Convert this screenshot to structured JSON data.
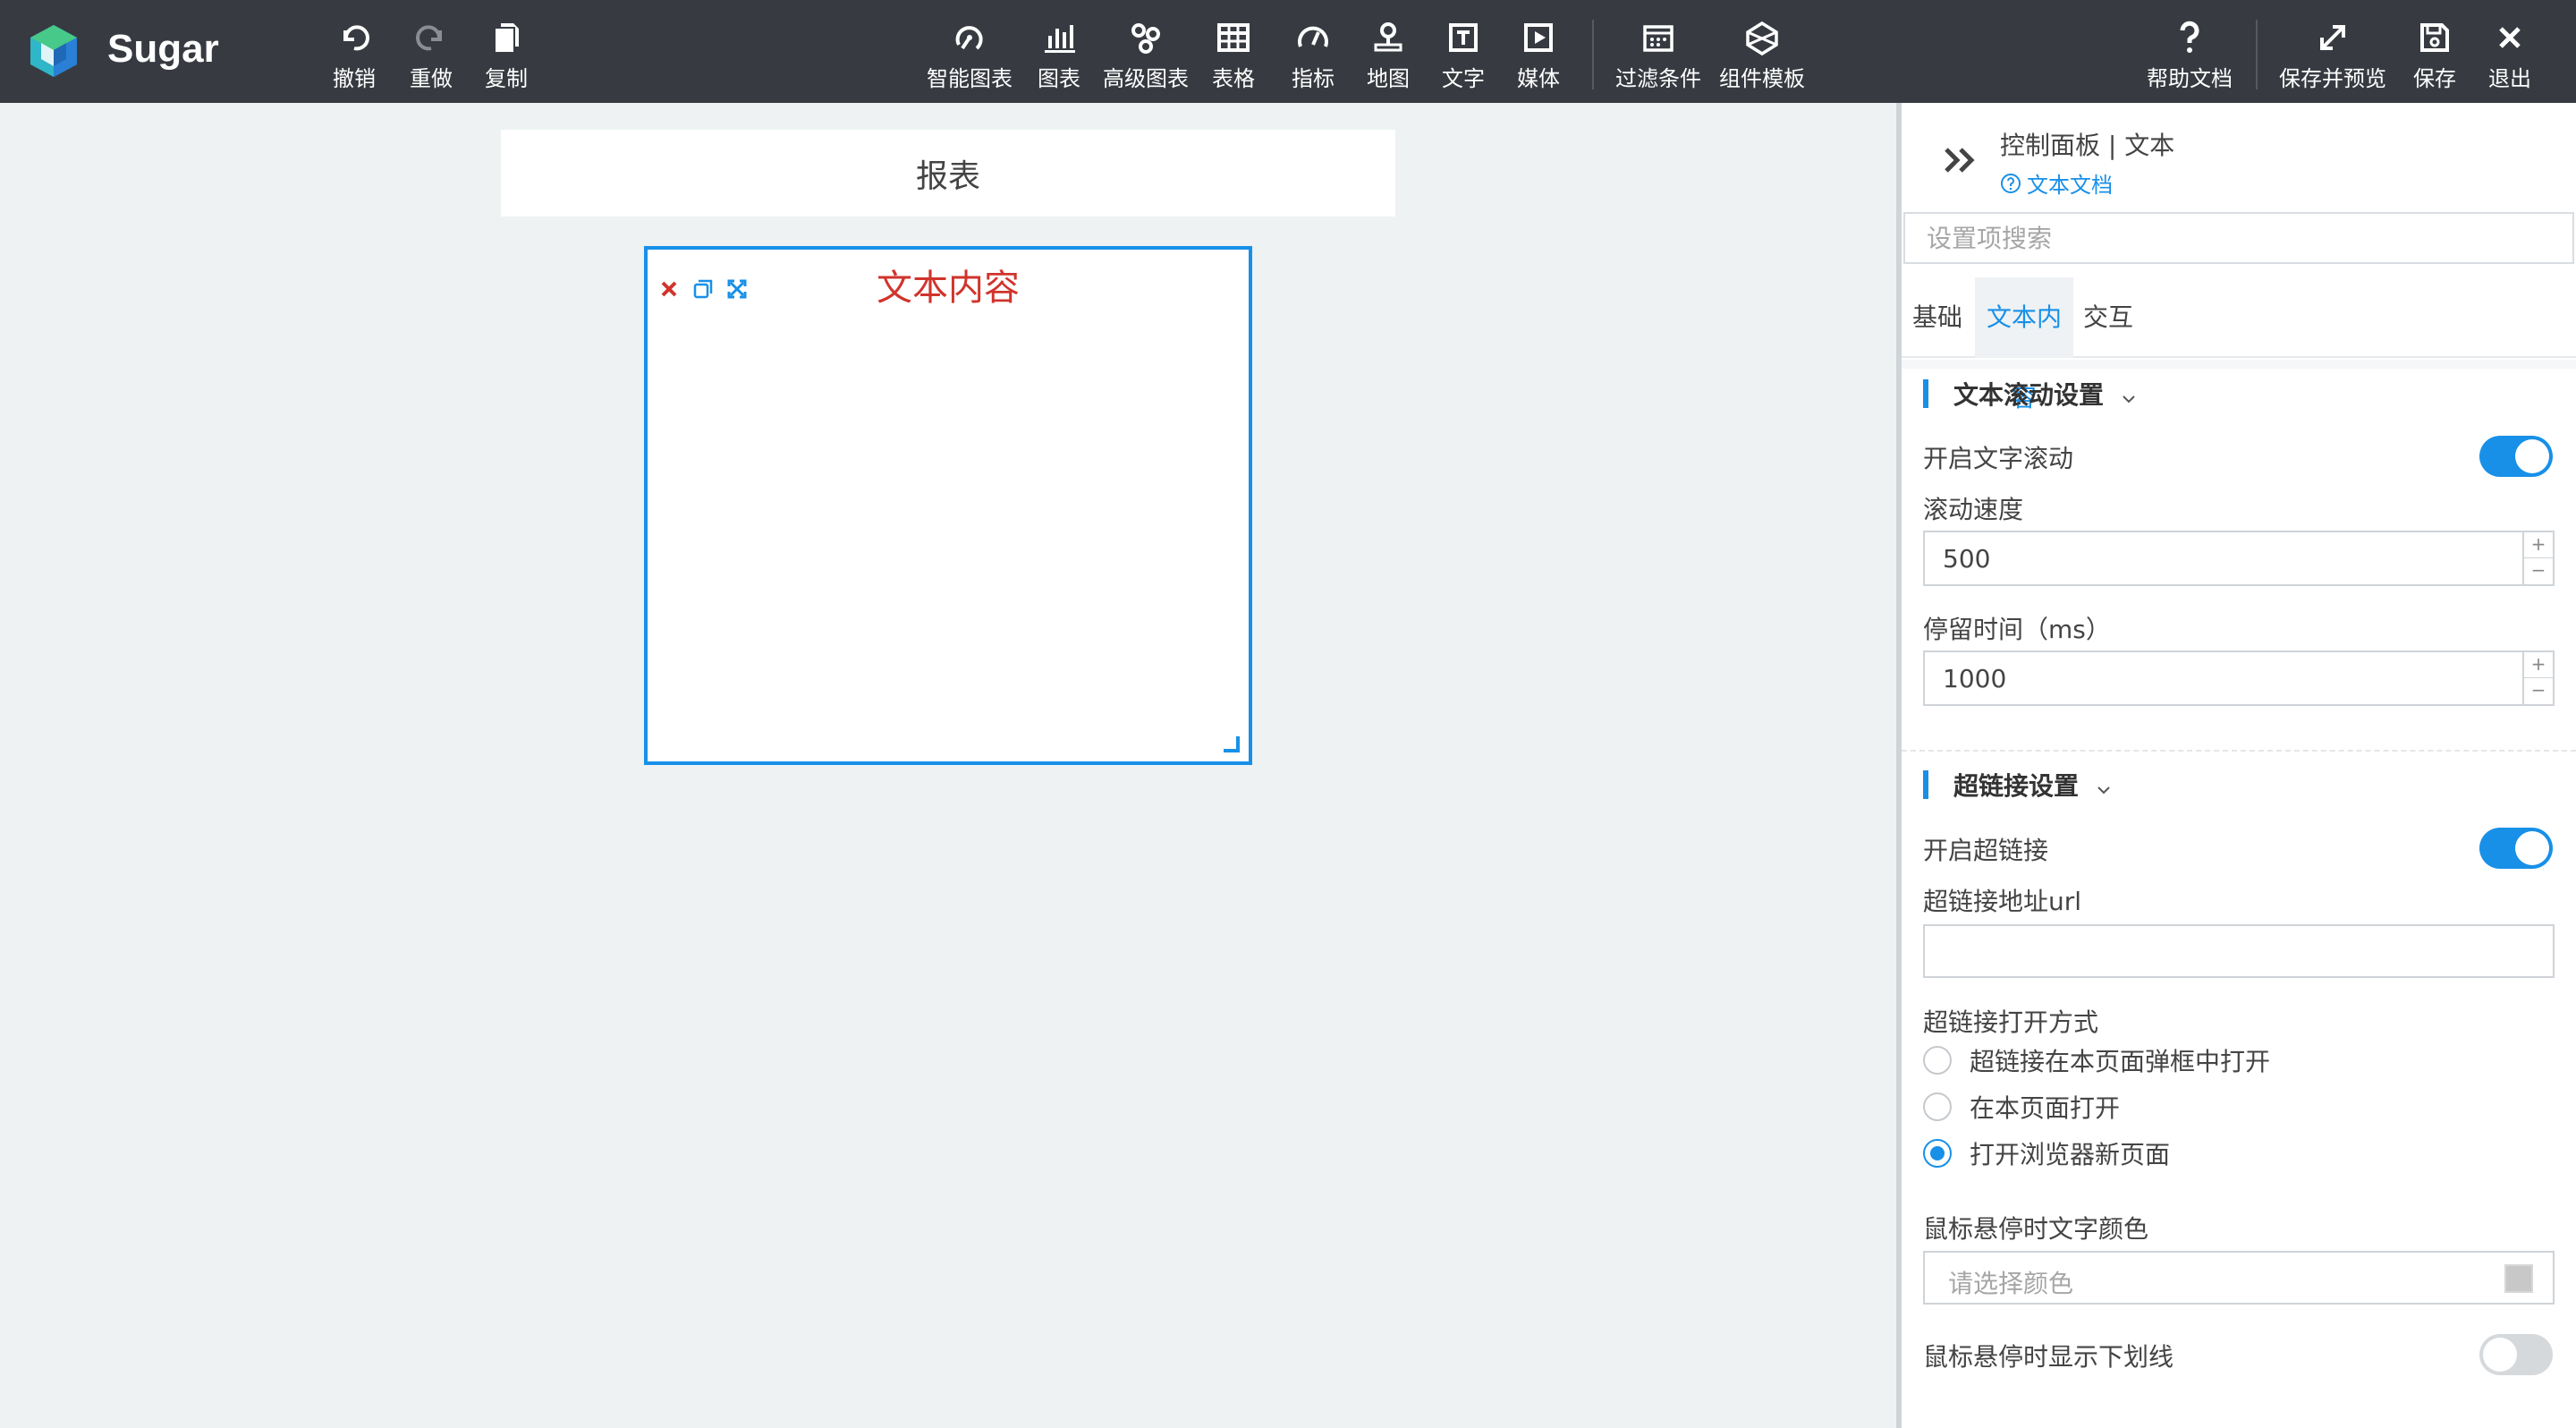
{
  "app": {
    "name": "Sugar",
    "accent_color": "#1890e8",
    "topbar_color": "#373b41",
    "canvas_color": "#eef2f3"
  },
  "toolbar": {
    "edit": [
      {
        "label": "撤销",
        "icon": "undo-icon"
      },
      {
        "label": "重做",
        "icon": "redo-icon"
      },
      {
        "label": "复制",
        "icon": "copy-icon"
      }
    ],
    "components": [
      {
        "label": "智能图表",
        "icon": "smart-chart-icon"
      },
      {
        "label": "图表",
        "icon": "bar-chart-icon"
      },
      {
        "label": "高级图表",
        "icon": "advanced-chart-icon"
      },
      {
        "label": "表格",
        "icon": "table-icon"
      },
      {
        "label": "指标",
        "icon": "gauge-icon"
      },
      {
        "label": "地图",
        "icon": "map-pin-icon"
      },
      {
        "label": "文字",
        "icon": "text-icon"
      },
      {
        "label": "媒体",
        "icon": "media-icon"
      }
    ],
    "extras": [
      {
        "label": "过滤条件",
        "icon": "filter-calendar-icon"
      },
      {
        "label": "组件模板",
        "icon": "template-icon"
      }
    ],
    "right": [
      {
        "label": "帮助文档",
        "icon": "help-icon"
      },
      {
        "label": "保存并预览",
        "icon": "expand-icon"
      },
      {
        "label": "保存",
        "icon": "save-icon"
      },
      {
        "label": "退出",
        "icon": "close-icon"
      }
    ]
  },
  "canvas": {
    "report_title": "报表",
    "widget": {
      "text": "文本内容",
      "text_color": "#d0342c"
    }
  },
  "panel": {
    "title": "控制面板 | 文本",
    "doc_link": "文本文档",
    "search_placeholder": "设置项搜索",
    "tabs": [
      {
        "label": "基础",
        "active": false
      },
      {
        "label": "文本内容",
        "active": true
      },
      {
        "label": "交互",
        "active": false
      }
    ],
    "scroll_section": {
      "heading": "文本滚动设置",
      "enable_label": "开启文字滚动",
      "enable_on": true,
      "speed_label": "滚动速度",
      "speed_value": "500",
      "stay_label": "停留时间（ms）",
      "stay_value": "1000"
    },
    "link_section": {
      "heading": "超链接设置",
      "enable_label": "开启超链接",
      "enable_on": true,
      "url_label": "超链接地址url",
      "url_value": "",
      "open_mode_label": "超链接打开方式",
      "open_modes": [
        {
          "label": "超链接在本页面弹框中打开",
          "checked": false
        },
        {
          "label": "在本页面打开",
          "checked": false
        },
        {
          "label": "打开浏览器新页面",
          "checked": true
        }
      ],
      "hover_color_label": "鼠标悬停时文字颜色",
      "hover_color_placeholder": "请选择颜色",
      "underline_label": "鼠标悬停时显示下划线",
      "underline_on": false
    }
  }
}
